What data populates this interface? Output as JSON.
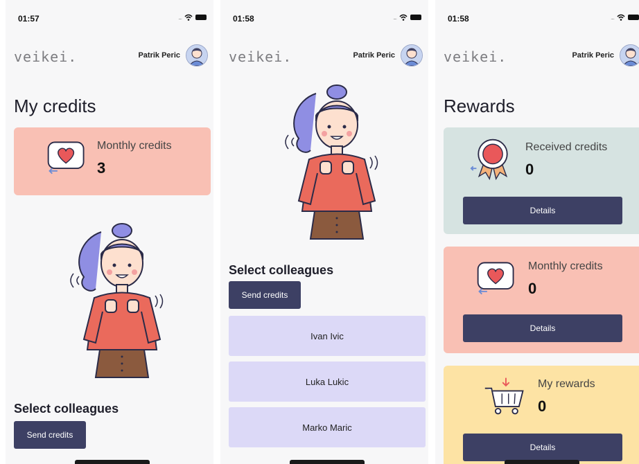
{
  "app": {
    "logo": "veikei.",
    "user_name": "Patrik Peric"
  },
  "screens": [
    {
      "time": "01:57",
      "title": "My credits",
      "card": {
        "label": "Monthly credits",
        "value": "3",
        "color": "#f9c0b4"
      },
      "section": "Select colleagues",
      "send_button": "Send credits"
    },
    {
      "time": "01:58",
      "section": "Select colleagues",
      "send_button": "Send credits",
      "colleagues": [
        "Ivan Ivic",
        "Luka Lukic",
        "Marko Maric"
      ]
    },
    {
      "time": "01:58",
      "title": "Rewards",
      "cards": [
        {
          "label": "Received credits",
          "value": "0",
          "button": "Details",
          "color": "#d6e3e1"
        },
        {
          "label": "Monthly credits",
          "value": "0",
          "button": "Details",
          "color": "#f9c0b4"
        },
        {
          "label": "My rewards",
          "value": "0",
          "button": "Details",
          "color": "#fde3a4"
        }
      ]
    }
  ],
  "colors": {
    "button": "#3d4064",
    "colleague_bg": "#dcd9f7",
    "heart": "#e9585a"
  }
}
